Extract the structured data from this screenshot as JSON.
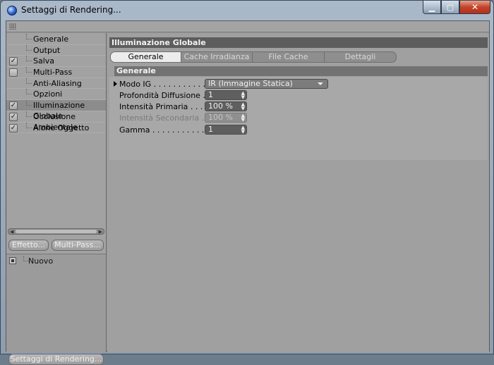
{
  "window": {
    "title": "Settaggi di Rendering...",
    "controls": {
      "minimize": "▁",
      "maximize": "▢",
      "close": "✕"
    }
  },
  "sidebar": {
    "items": [
      {
        "label": "Generale",
        "checkbox": false,
        "checked": false,
        "active": false
      },
      {
        "label": "Output",
        "checkbox": false,
        "checked": false,
        "active": false
      },
      {
        "label": "Salva",
        "checkbox": true,
        "checked": true,
        "active": false
      },
      {
        "label": "Multi-Pass",
        "checkbox": true,
        "checked": false,
        "active": false
      },
      {
        "label": "Anti-Aliasing",
        "checkbox": false,
        "checked": false,
        "active": false
      },
      {
        "label": "Opzioni",
        "checkbox": false,
        "checked": false,
        "active": false
      },
      {
        "label": "Illuminazione Globale",
        "checkbox": true,
        "checked": true,
        "active": true
      },
      {
        "label": "Occlusione Ambientale",
        "checkbox": true,
        "checked": true,
        "active": false
      },
      {
        "label": "Alone Oggetto",
        "checkbox": true,
        "checked": true,
        "active": false
      }
    ],
    "effect_button": "Effetto...",
    "multipass_button": "Multi-Pass...",
    "lower_items": [
      {
        "label": "Nuovo"
      }
    ],
    "bottom_button": "Settaggi di Rendering..."
  },
  "main": {
    "section_title": "Illuminazione Globale",
    "tabs": [
      {
        "label": "Generale",
        "active": true
      },
      {
        "label": "Cache Irradianza",
        "active": false
      },
      {
        "label": "File Cache Irradianza",
        "active": false
      },
      {
        "label": "Dettagli",
        "active": false
      }
    ],
    "subsection_title": "Generale",
    "fields": [
      {
        "label": "Modo IG . . . . . . . . . . . . .",
        "value": "IR (Immagine Statica)",
        "type": "dropdown",
        "disabled": false,
        "expandable": true
      },
      {
        "label": "Profondità Diffusione . . .",
        "value": "1",
        "type": "number",
        "disabled": false,
        "expandable": false
      },
      {
        "label": "Intensità Primaria . . . . . .",
        "value": "100 %",
        "type": "number",
        "disabled": false,
        "expandable": false
      },
      {
        "label": "Intensità Secondaria . . .",
        "value": "100 %",
        "type": "number",
        "disabled": true,
        "expandable": false
      },
      {
        "label": "Gamma . . . . . . . . . . . . . .",
        "value": "1",
        "type": "number",
        "disabled": false,
        "expandable": false
      }
    ]
  },
  "icons": {
    "app": "cinema4d-sphere-icon",
    "grip": "grip-dots-icon",
    "checkmark": "✓",
    "spinner": "▲▼"
  }
}
